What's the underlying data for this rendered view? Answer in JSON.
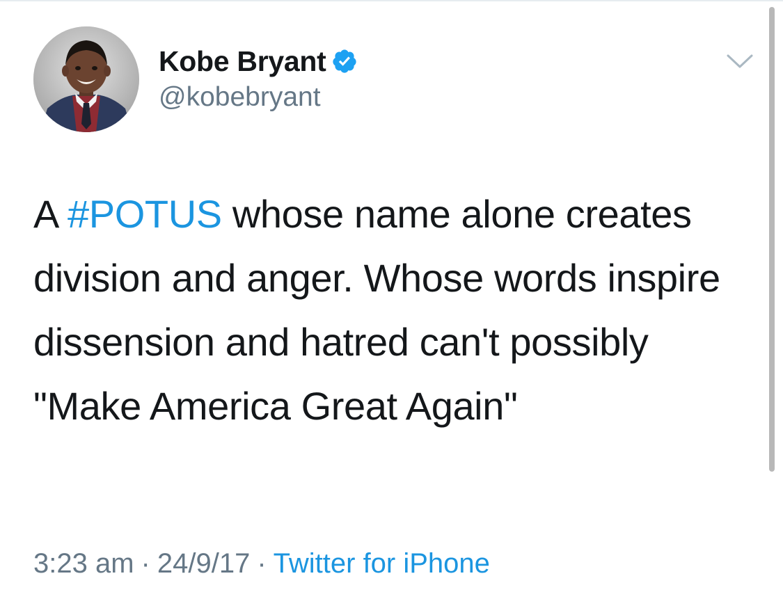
{
  "tweet": {
    "author": {
      "display_name": "Kobe Bryant",
      "handle": "@kobebryant",
      "verified": true,
      "verified_icon": "verified-badge-icon",
      "avatar_icon": "profile-photo"
    },
    "body": {
      "prefix": "A",
      "hashtag": "#POTUS",
      "text": "whose name alone creates division and anger. Whose words inspire dissension and hatred can't possibly \"Make America Great Again\""
    },
    "meta": {
      "time": "3:23 am",
      "separator": "·",
      "date": "24/9/17",
      "source": "Twitter for iPhone"
    },
    "menu_icon": "chevron-down-icon"
  },
  "colors": {
    "text": "#14171a",
    "secondary": "#657786",
    "link": "#1b95e0",
    "verified": "#1da1f2"
  }
}
